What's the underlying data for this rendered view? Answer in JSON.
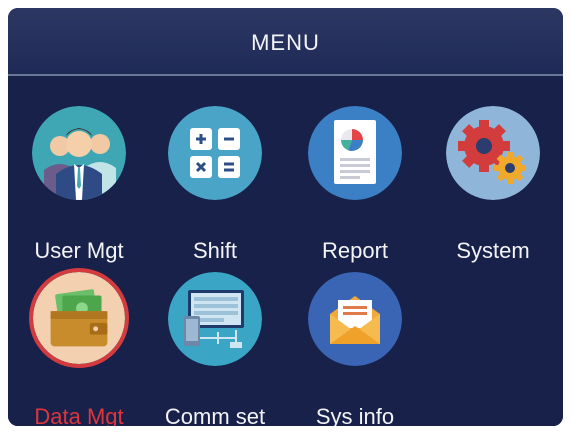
{
  "header": {
    "title": "MENU"
  },
  "menu": {
    "items": [
      {
        "label": "User Mgt",
        "icon": "users-icon"
      },
      {
        "label": "Shift",
        "icon": "calculator-icon"
      },
      {
        "label": "Report",
        "icon": "report-icon"
      },
      {
        "label": "System",
        "icon": "gears-icon"
      },
      {
        "label": "Data Mgt",
        "icon": "wallet-icon",
        "selected": true
      },
      {
        "label": "Comm set",
        "icon": "network-icon"
      },
      {
        "label": "Sys info",
        "icon": "envelope-icon"
      }
    ]
  },
  "colors": {
    "background": "#1e2a55",
    "selected_label": "#e0353a",
    "text": "#f4f4f7"
  }
}
